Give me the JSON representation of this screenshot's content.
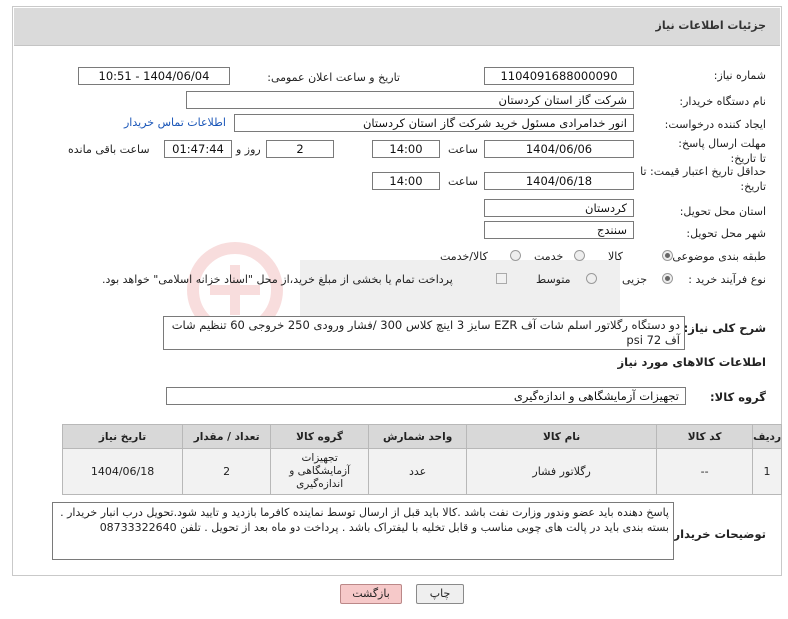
{
  "header": {
    "title": "جزئیات اطلاعات نیاز"
  },
  "fields": {
    "need_number_label": "شماره نیاز:",
    "need_number": "1104091688000090",
    "announce_label": "تاریخ و ساعت اعلان عمومی:",
    "announce_value": "1404/06/04 - 10:51",
    "buyer_org_label": "نام دستگاه خریدار:",
    "buyer_org": "شرکت گاز استان کردستان",
    "creator_label": "ایجاد کننده درخواست:",
    "creator": "انور خدامرادی مسئول خرید  شرکت گاز استان کردستان",
    "contact_link": "اطلاعات تماس خریدار",
    "reply_deadline_label": "مهلت ارسال پاسخ: تا تاریخ:",
    "reply_date": "1404/06/06",
    "hour_label": "ساعت",
    "reply_hour": "14:00",
    "days_value": "2",
    "days_label": "روز و",
    "remaining_time": "01:47:44",
    "remaining_label": "ساعت باقی مانده",
    "price_validity_label": "حداقل تاریخ اعتبار قیمت: تا تاریخ:",
    "validity_date": "1404/06/18",
    "validity_hour": "14:00",
    "province_label": "استان محل تحویل:",
    "province": "کردستان",
    "city_label": "شهر محل تحویل:",
    "city": "سنندج",
    "category_label": "طبقه بندی موضوعی:",
    "category_options": [
      "کالا",
      "خدمت",
      "کالا/خدمت"
    ],
    "process_label": "نوع فرآیند خرید :",
    "process_options": [
      "جزیی",
      "متوسط"
    ],
    "payment_note": "پرداخت تمام یا بخشی از مبلغ خرید،از محل \"اسناد خزانه اسلامی\" خواهد بود."
  },
  "description": {
    "label": "شرح کلی نیاز:",
    "text": "دو دستگاه رگلاتور اسلم شات آف EZR سایز 3 اینچ کلاس 300 /فشار ورودی 250 خروجی 60 تنظیم شات آف 72 psi"
  },
  "goods_section_title": "اطلاعات کالاهای مورد نیاز",
  "goods_group": {
    "label": "گروه کالا:",
    "value": "تجهیزات آزمایشگاهی و اندازه‌گیری"
  },
  "table": {
    "headers": [
      "ردیف",
      "کد کالا",
      "نام کالا",
      "واحد شمارش",
      "گروه کالا",
      "تعداد / مقدار",
      "تاریخ نیاز"
    ],
    "rows": [
      {
        "row": "1",
        "code": "--",
        "name": "رگلاتور فشار",
        "unit": "عدد",
        "group": "تجهیزات آزمایشگاهی و اندازه‌گیری",
        "qty": "2",
        "date": "1404/06/18"
      }
    ]
  },
  "buyer_notes": {
    "label": "توضیحات خریدار:",
    "text": "پاسخ دهنده باید عضو وندور وزارت نفت باشد .کالا باید قبل از ارسال توسط نماینده کافرما بازدید و تایید شود.تحویل درب انبار خریدار . بسته بندی باید در پالت های چوبی مناسب و قابل تخلیه با لیفتراک باشد . پرداخت دو ماه بعد از تحویل . تلفن 08733322640"
  },
  "buttons": {
    "print": "چاپ",
    "back": "بازگشت"
  },
  "colors": {
    "header_bg": "#dadada",
    "link": "#1a56b8",
    "back_button": "#f6c9c9"
  }
}
